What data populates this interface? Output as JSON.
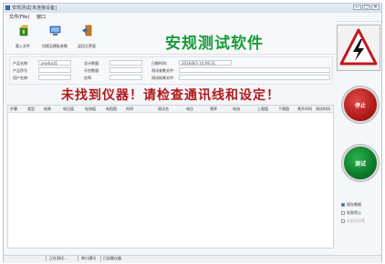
{
  "window": {
    "title": "安规测试[未连接设备]",
    "controls": [
      "—",
      "□",
      "✕"
    ]
  },
  "menu": [
    "文件(File)",
    "窗口"
  ],
  "toolbar": [
    {
      "label": "载入文件",
      "icon": "load-file-icon"
    },
    {
      "label": "切换至模板参数",
      "icon": "switch-template-icon"
    },
    {
      "label": "返回主界面",
      "icon": "return-main-icon"
    }
  ],
  "app_title": "安规测试软件",
  "info": {
    "product_name_label": "产品名称:",
    "product_name_value": "product1",
    "product_no_label": "产品序号",
    "user_name_label": "用户名称:",
    "total_qty_label": "总计数量:",
    "bad_qty_label": "不良数量:",
    "yield_label": "良率:",
    "datetime_label": "日期时间:",
    "datetime_value": "2016/8/3 14:09:31",
    "test_param_file_label": "测试参数文件:",
    "test_result_file_label": "测试结果文件:"
  },
  "status_message": "未找到仪器！请检查通讯线和设定！",
  "grid": {
    "columns": [
      "步骤",
      "类型",
      "结果",
      "电压值",
      "电流值",
      "电阻值",
      "时间",
      "测试名",
      "电压",
      "频率",
      "电流",
      "上限值",
      "下限值",
      "爬升时间",
      "测试时间"
    ]
  },
  "buttons": {
    "stop": "停止",
    "test": "测试"
  },
  "options": [
    {
      "label": "保存数据",
      "checked": true,
      "enabled": true
    },
    {
      "label": "失败停止",
      "checked": false,
      "enabled": true
    },
    {
      "label": "关机时回零",
      "checked": false,
      "enabled": false
    }
  ],
  "statusbar": [
    "正在测试...",
    "串口通讯",
    "已加载仪器"
  ],
  "colors": {
    "title_green": "#1a9b3b",
    "error_red": "#b1191c",
    "stop_red": "#b01a1a",
    "test_green": "#0d7a2a",
    "warning_red": "#c0191f"
  }
}
